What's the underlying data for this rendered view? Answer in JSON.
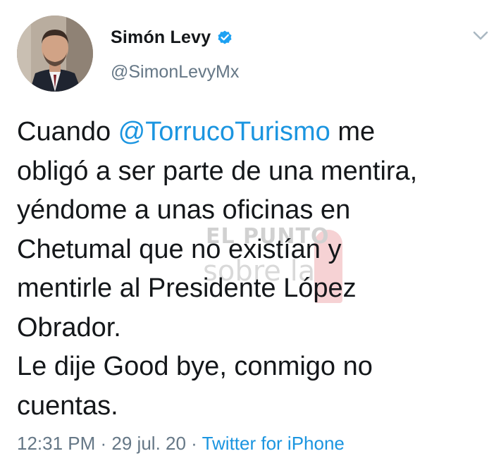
{
  "author": {
    "name": "Simón Levy",
    "handle": "@SimonLevyMx",
    "verified": true
  },
  "tweet": {
    "line1_prefix": "Cuando ",
    "line1_mention": "@TorrucoTurismo",
    "line1_suffix": " me",
    "line2": "obligó a ser parte de una mentira,",
    "line3": "yéndome a unas oficinas en",
    "line4": "Chetumal que no existían y",
    "line5": "mentirle al Presidente López",
    "line6": "Obrador.",
    "line7": "Le dije Good bye, conmigo no",
    "line8": "cuentas."
  },
  "meta": {
    "time": "12:31 PM",
    "separator": " · ",
    "date": "29 jul. 20",
    "source": "Twitter for iPhone"
  },
  "watermark": {
    "top": "EL PUNTO",
    "bottom": "sobre la"
  },
  "colors": {
    "link": "#1b95e0",
    "secondary": "#657786",
    "text": "#14171a",
    "verified": "#1da1f2"
  },
  "icons": {
    "verified": "verified-badge-icon",
    "menu": "chevron-down-icon"
  }
}
